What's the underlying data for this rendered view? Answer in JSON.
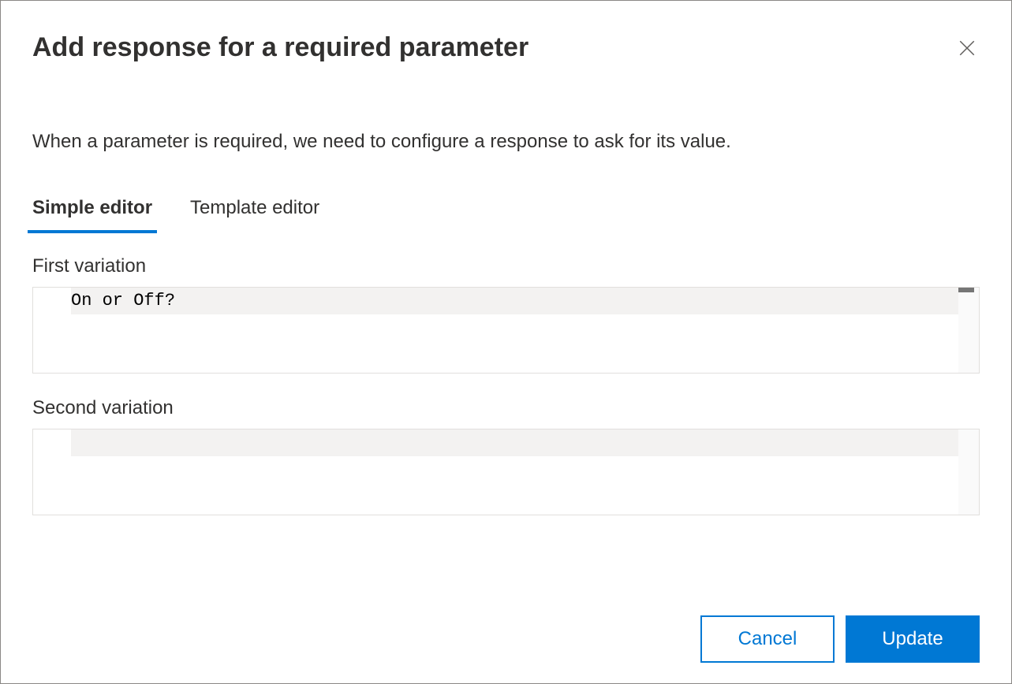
{
  "dialog": {
    "title": "Add response for a required parameter",
    "description": "When a parameter is required, we need to configure a response to ask for its value."
  },
  "tabs": {
    "simple_editor": "Simple editor",
    "template_editor": "Template editor"
  },
  "fields": {
    "first_variation": {
      "label": "First variation",
      "value": "On or Off?"
    },
    "second_variation": {
      "label": "Second variation",
      "value": ""
    }
  },
  "footer": {
    "cancel": "Cancel",
    "update": "Update"
  }
}
